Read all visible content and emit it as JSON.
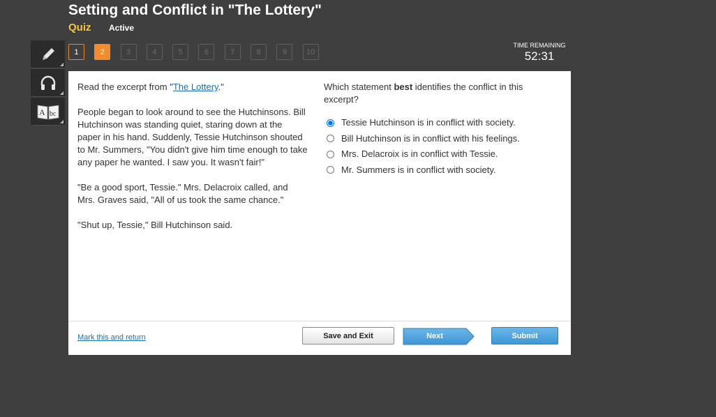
{
  "header": {
    "title": "Setting and Conflict in \"The Lottery\"",
    "subtitle": "Quiz",
    "status": "Active"
  },
  "toolbar": {
    "tools": [
      {
        "name": "pencil-tool",
        "icon": "pencil-icon"
      },
      {
        "name": "audio-tool",
        "icon": "headphones-icon"
      },
      {
        "name": "dictionary-tool",
        "icon": "dictionary-icon"
      }
    ]
  },
  "question_nav": {
    "items": [
      "1",
      "2",
      "3",
      "4",
      "5",
      "6",
      "7",
      "8",
      "9",
      "10"
    ],
    "current": "2",
    "visited": [
      "1"
    ]
  },
  "timer": {
    "label": "TIME REMAINING",
    "value": "52:31"
  },
  "passage": {
    "intro_prefix": "Read the excerpt from \"",
    "intro_link": "The Lottery",
    "intro_suffix": ".\"",
    "paragraphs": [
      "People began to look around to see the Hutchinsons. Bill Hutchinson was standing quiet, staring down at the paper in his hand. Suddenly, Tessie Hutchinson shouted to Mr. Summers, \"You didn't give him time enough to take any paper he wanted. I saw you. It wasn't fair!\"",
      "\"Be a good sport, Tessie.\" Mrs. Delacroix called, and Mrs. Graves said, \"All of us took the same chance.\"",
      "\"Shut up, Tessie,\" Bill Hutchinson said."
    ]
  },
  "question": {
    "prompt_before": "Which statement ",
    "prompt_bold": "best",
    "prompt_after": " identifies the conflict in this excerpt?",
    "options": [
      {
        "label": "Tessie Hutchinson is in conflict with society.",
        "selected": true
      },
      {
        "label": "Bill Hutchinson is in conflict with his feelings.",
        "selected": false
      },
      {
        "label": "Mrs. Delacroix is in conflict with Tessie.",
        "selected": false
      },
      {
        "label": "Mr. Summers is in conflict with society.",
        "selected": false
      }
    ]
  },
  "footer": {
    "mark_label": "Mark this and return",
    "save_label": "Save and Exit",
    "next_label": "Next",
    "submit_label": "Submit"
  },
  "colors": {
    "background": "#3f3f3f",
    "accent_orange": "#f18b2d",
    "subtitle_yellow": "#f5c542",
    "button_blue": "#3c97d6",
    "link_blue": "#1a6fb0"
  }
}
